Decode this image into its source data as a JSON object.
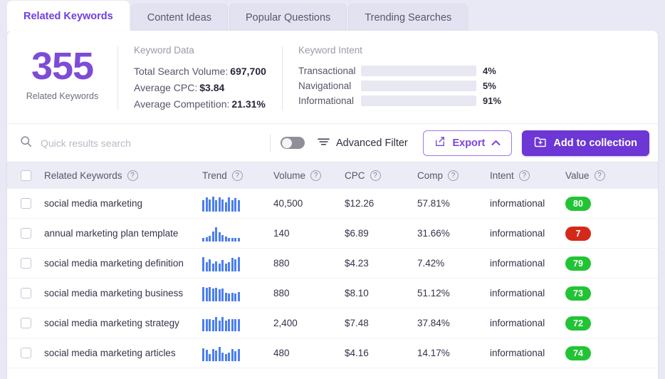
{
  "tabs": [
    {
      "label": "Related Keywords",
      "active": true
    },
    {
      "label": "Content Ideas",
      "active": false
    },
    {
      "label": "Popular Questions",
      "active": false
    },
    {
      "label": "Trending Searches",
      "active": false
    }
  ],
  "summary": {
    "count": "355",
    "count_label": "Related Keywords",
    "keyword_data": {
      "title": "Keyword Data",
      "rows": [
        {
          "label": "Total Search Volume:",
          "value": "697,700"
        },
        {
          "label": "Average CPC:",
          "value": "$3.84"
        },
        {
          "label": "Average Competition:",
          "value": "21.31%"
        }
      ]
    },
    "keyword_intent": {
      "title": "Keyword Intent",
      "rows": [
        {
          "name": "Transactional",
          "pct": "4%",
          "value": 4,
          "color": "#d93b29"
        },
        {
          "name": "Navigational",
          "pct": "5%",
          "value": 5,
          "color": "#fcb415"
        },
        {
          "name": "Informational",
          "pct": "91%",
          "value": 91,
          "color": "#22c435"
        }
      ]
    }
  },
  "toolbar": {
    "search_placeholder": "Quick results search",
    "search_value": "",
    "toggle_on": false,
    "advanced_filter_label": "Advanced Filter",
    "export_label": "Export",
    "add_to_collection_label": "Add to collection"
  },
  "table": {
    "columns": [
      {
        "key": "keyword",
        "label": "Related Keywords",
        "help": true
      },
      {
        "key": "trend",
        "label": "Trend",
        "help": true
      },
      {
        "key": "volume",
        "label": "Volume",
        "help": true
      },
      {
        "key": "cpc",
        "label": "CPC",
        "help": true
      },
      {
        "key": "comp",
        "label": "Comp",
        "help": true
      },
      {
        "key": "intent",
        "label": "Intent",
        "help": true
      },
      {
        "key": "value",
        "label": "Value",
        "help": true
      }
    ],
    "rows": [
      {
        "keyword": "social media marketing",
        "trend": [
          16,
          20,
          17,
          21,
          16,
          20,
          17,
          13,
          20,
          16,
          19,
          16
        ],
        "volume": "40,500",
        "cpc": "$12.26",
        "comp": "57.81%",
        "intent": "informational",
        "value": "80",
        "value_color": "#22c435"
      },
      {
        "keyword": "annual marketing plan template",
        "trend": [
          5,
          6,
          8,
          14,
          20,
          13,
          9,
          7,
          5,
          5,
          5,
          5
        ],
        "volume": "140",
        "cpc": "$6.89",
        "comp": "31.66%",
        "intent": "informational",
        "value": "7",
        "value_color": "#d4291a"
      },
      {
        "keyword": "social media marketing definition",
        "trend": [
          20,
          13,
          17,
          11,
          14,
          11,
          16,
          11,
          13,
          19,
          17,
          20
        ],
        "volume": "880",
        "cpc": "$4.23",
        "comp": "7.42%",
        "intent": "informational",
        "value": "79",
        "value_color": "#22c435"
      },
      {
        "keyword": "social media marketing business",
        "trend": [
          20,
          19,
          20,
          18,
          19,
          17,
          18,
          12,
          11,
          12,
          11,
          13
        ],
        "volume": "880",
        "cpc": "$8.10",
        "comp": "51.12%",
        "intent": "informational",
        "value": "73",
        "value_color": "#22c435"
      },
      {
        "keyword": "social media marketing strategy",
        "trend": [
          17,
          17,
          17,
          16,
          20,
          15,
          20,
          15,
          17,
          17,
          17,
          17
        ],
        "volume": "2,400",
        "cpc": "$7.48",
        "comp": "37.84%",
        "intent": "informational",
        "value": "72",
        "value_color": "#22c435"
      },
      {
        "keyword": "social media marketing articles",
        "trend": [
          18,
          16,
          10,
          17,
          15,
          20,
          12,
          10,
          12,
          17,
          14,
          17
        ],
        "volume": "480",
        "cpc": "$4.16",
        "comp": "14.17%",
        "intent": "informational",
        "value": "74",
        "value_color": "#22c435"
      }
    ]
  }
}
